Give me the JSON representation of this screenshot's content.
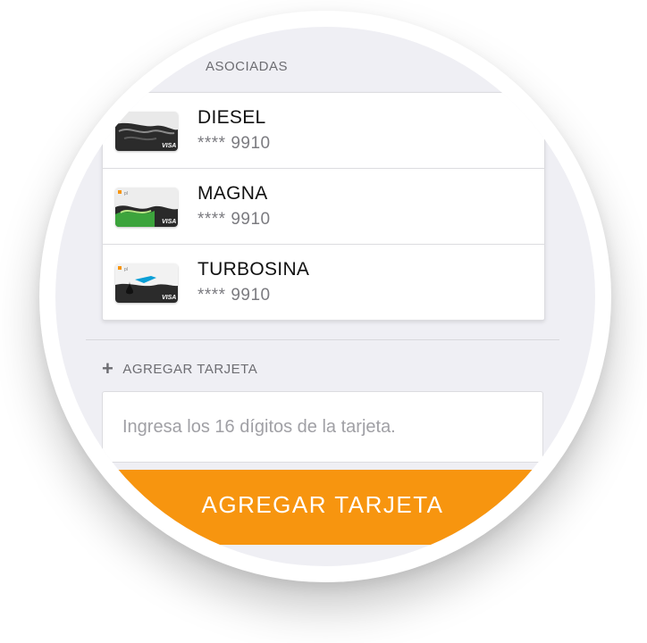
{
  "sections": {
    "associated_header": "ASOCIADAS",
    "add_header": "AGREGAR TARJETA"
  },
  "cards": [
    {
      "name": "DIESEL",
      "number": "**** 9910",
      "theme": "dark",
      "accent": "#2b2b2b",
      "brand": "VISA"
    },
    {
      "name": "MAGNA",
      "number": "**** 9910",
      "theme": "green",
      "accent": "#3ca43c",
      "brand": "VISA"
    },
    {
      "name": "TURBOSINA",
      "number": "**** 9910",
      "theme": "sky",
      "accent": "#0a9fd6",
      "brand": "VISA"
    }
  ],
  "add_card": {
    "input_placeholder": "Ingresa los 16 dígitos de la tarjeta.",
    "input_value": "",
    "button_label": "AGREGAR TARJETA"
  },
  "colors": {
    "accent": "#f7950f",
    "background": "#efeff4"
  },
  "icons": {
    "add": "plus-icon"
  }
}
